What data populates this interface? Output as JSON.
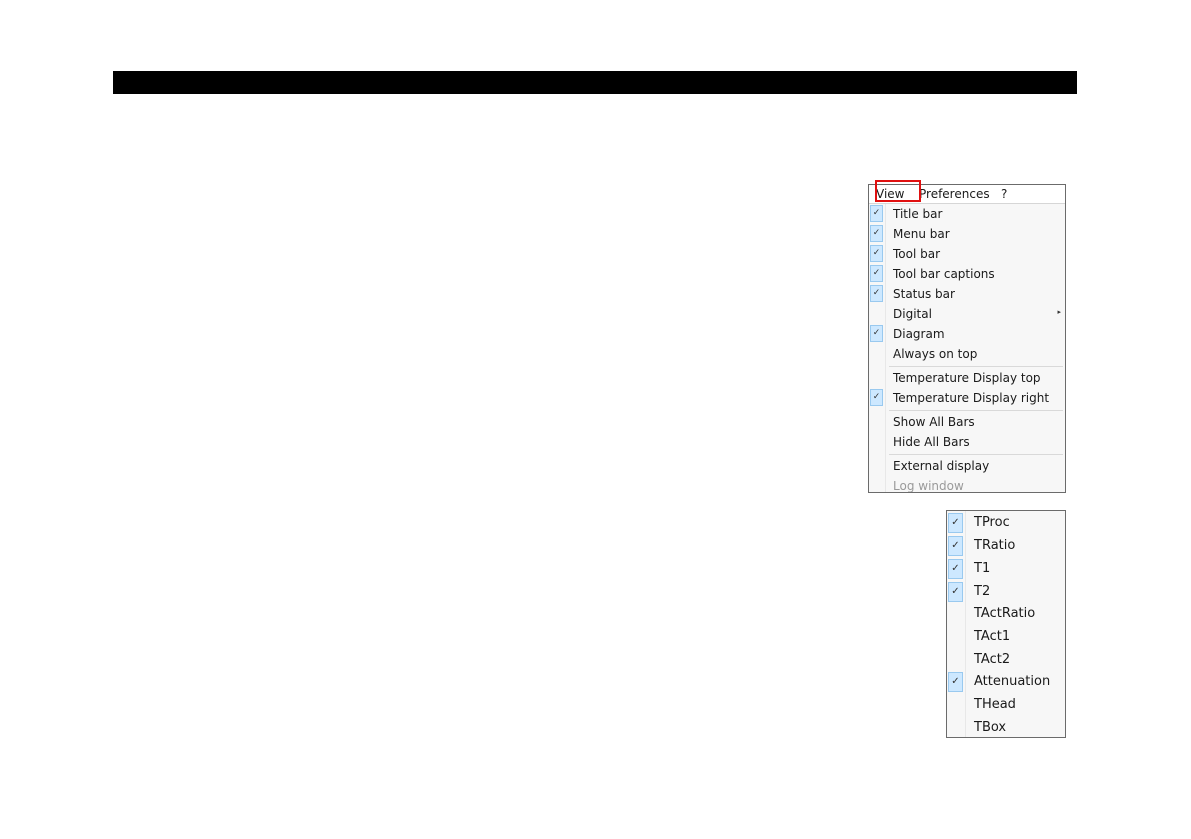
{
  "colors": {
    "header_bar": "#000000",
    "highlight": "#e01010",
    "check_bg": "#cde8ff"
  },
  "menubar": {
    "view": "View",
    "preferences": "Preferences",
    "help": "?"
  },
  "view_menu": {
    "items": [
      {
        "label": "Title bar",
        "checked": true
      },
      {
        "label": "Menu bar",
        "checked": true
      },
      {
        "label": "Tool bar",
        "checked": true
      },
      {
        "label": "Tool bar captions",
        "checked": true
      },
      {
        "label": "Status bar",
        "checked": true
      },
      {
        "label": "Digital",
        "checked": false,
        "submenu": true
      },
      {
        "label": "Diagram",
        "checked": true
      },
      {
        "label": "Always on top",
        "checked": false
      },
      {
        "label": "Temperature Display top",
        "checked": false
      },
      {
        "label": "Temperature Display right",
        "checked": true
      },
      {
        "label": "Show All Bars",
        "checked": false
      },
      {
        "label": "Hide All Bars",
        "checked": false
      },
      {
        "label": "External display",
        "checked": false
      },
      {
        "label": "Log window",
        "checked": false,
        "disabled": true
      }
    ],
    "check_glyph": "✓",
    "submenu_glyph": "▸"
  },
  "digital_menu": {
    "items": [
      {
        "label": "TProc",
        "checked": true
      },
      {
        "label": "TRatio",
        "checked": true
      },
      {
        "label": "T1",
        "checked": true
      },
      {
        "label": "T2",
        "checked": true
      },
      {
        "label": "TActRatio",
        "checked": false
      },
      {
        "label": "TAct1",
        "checked": false
      },
      {
        "label": "TAct2",
        "checked": false
      },
      {
        "label": "Attenuation",
        "checked": true
      },
      {
        "label": "THead",
        "checked": false
      },
      {
        "label": "TBox",
        "checked": false
      }
    ]
  }
}
